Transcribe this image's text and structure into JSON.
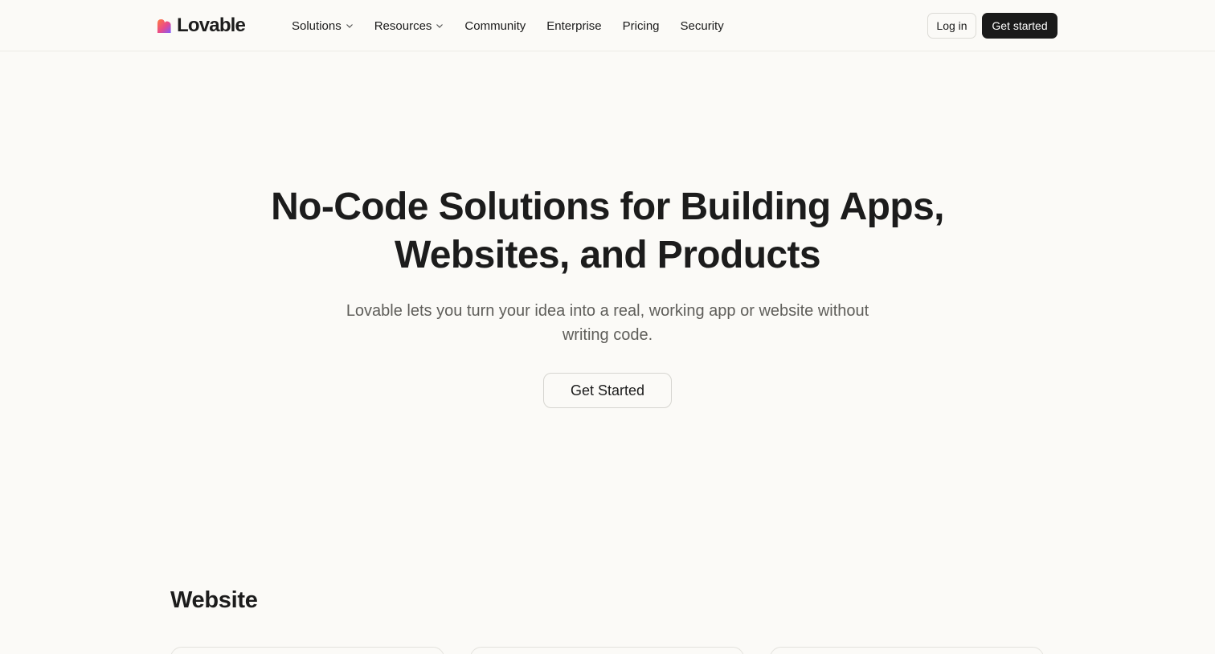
{
  "brand": {
    "name": "Lovable",
    "logo_icon": "heart-gradient-icon",
    "colors": {
      "orange": "#ff7a3d",
      "pink": "#e84a8c",
      "purple": "#7a5cff"
    }
  },
  "nav": {
    "items": [
      {
        "label": "Solutions",
        "has_dropdown": true
      },
      {
        "label": "Resources",
        "has_dropdown": true
      },
      {
        "label": "Community",
        "has_dropdown": false
      },
      {
        "label": "Enterprise",
        "has_dropdown": false
      },
      {
        "label": "Pricing",
        "has_dropdown": false
      },
      {
        "label": "Security",
        "has_dropdown": false
      }
    ],
    "login_label": "Log in",
    "get_started_label": "Get started"
  },
  "hero": {
    "title_line1": "No-Code Solutions for Building Apps,",
    "title_line2": "Websites, and Products",
    "subtitle_line1": "Lovable lets you turn your idea into a real, working app or website without",
    "subtitle_line2": "writing code.",
    "cta_label": "Get Started"
  },
  "section": {
    "title": "Website",
    "cards_visible": 3
  }
}
